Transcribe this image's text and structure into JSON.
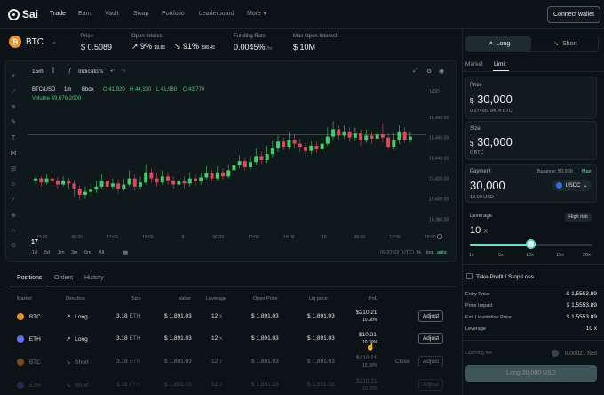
{
  "nav": {
    "brand": "Sai",
    "items": [
      "Trade",
      "Earn",
      "Vault",
      "Swap",
      "Portfolio",
      "Leaderboard",
      "More"
    ],
    "connect_wallet": "Connect wallet"
  },
  "market": {
    "symbol": "BTC",
    "price_label": "Price",
    "price": "$ 0.5089",
    "open_interest_label": "Open Interest",
    "oi_long_pct": "9%",
    "oi_long_val": "$9.85",
    "oi_short_pct": "91%",
    "oi_short_val": "$98.45",
    "funding_label": "Funding Rate",
    "funding": "0.0045%",
    "funding_unit": "/hr",
    "max_oi_label": "Max Open Interest",
    "max_oi": "$ 10M"
  },
  "chart_toolbar": {
    "interval": "15m",
    "indicators": "Indicators"
  },
  "chart_legend": {
    "pair": "BTC/USD",
    "tf": "1m",
    "exchange": "Bbox",
    "o": "O 41,920",
    "h": "H 44,330",
    "l": "L 41,960",
    "c": "C 43,770",
    "volume": "Volume 49,676,2000",
    "unit": "USD"
  },
  "chart_footer": {
    "ranges": [
      "1d",
      "5d",
      "1m",
      "3m",
      "6m",
      "All"
    ],
    "time": "09:27:02 (UTC)",
    "pct": "%",
    "log": "log",
    "auto": "auto"
  },
  "chart_data": {
    "type": "candlestick",
    "y_ticks": [
      "15,480.00",
      "15,460.00",
      "15,440.00",
      "15,420.00",
      "15,400.00",
      "15,380.00"
    ],
    "x_ticks": [
      "12:00",
      "06:00",
      "12:00",
      "18:00",
      "8",
      "06:00",
      "12:00",
      "18:00",
      "15",
      "06:00",
      "12:00",
      "18:00"
    ],
    "ylim": [
      15370,
      15492
    ],
    "candles": [
      [
        15418,
        15420,
        15423,
        15414
      ],
      [
        15420,
        15416,
        15422,
        15412
      ],
      [
        15416,
        15420,
        15424,
        15414
      ],
      [
        15420,
        15418,
        15423,
        15413
      ],
      [
        15418,
        15414,
        15421,
        15410
      ],
      [
        15414,
        15418,
        15422,
        15412
      ],
      [
        15418,
        15415,
        15421,
        15409
      ],
      [
        15415,
        15410,
        15418,
        15402
      ],
      [
        15410,
        15404,
        15413,
        15399
      ],
      [
        15404,
        15407,
        15412,
        15400
      ],
      [
        15407,
        15409,
        15414,
        15403
      ],
      [
        15409,
        15412,
        15418,
        15406
      ],
      [
        15412,
        15418,
        15424,
        15410
      ],
      [
        15418,
        15412,
        15422,
        15408
      ],
      [
        15412,
        15415,
        15420,
        15409
      ],
      [
        15415,
        15410,
        15419,
        15406
      ],
      [
        15410,
        15414,
        15420,
        15408
      ],
      [
        15414,
        15420,
        15428,
        15412
      ],
      [
        15420,
        15412,
        15424,
        15408
      ],
      [
        15412,
        15416,
        15422,
        15410
      ],
      [
        15416,
        15426,
        15434,
        15414
      ],
      [
        15426,
        15420,
        15430,
        15416
      ],
      [
        15420,
        15416,
        15426,
        15412
      ],
      [
        15416,
        15422,
        15428,
        15414
      ],
      [
        15422,
        15418,
        15426,
        15414
      ],
      [
        15418,
        15414,
        15422,
        15410
      ],
      [
        15414,
        15418,
        15424,
        15412
      ],
      [
        15418,
        15415,
        15422,
        15410
      ],
      [
        15415,
        15420,
        15426,
        15412
      ],
      [
        15420,
        15417,
        15424,
        15413
      ],
      [
        15417,
        15421,
        15426,
        15414
      ],
      [
        15421,
        15425,
        15432,
        15419
      ],
      [
        15425,
        15420,
        15429,
        15417
      ],
      [
        15420,
        15426,
        15432,
        15418
      ],
      [
        15426,
        15422,
        15430,
        15419
      ],
      [
        15422,
        15428,
        15434,
        15420
      ],
      [
        15428,
        15433,
        15440,
        15425
      ],
      [
        15433,
        15437,
        15443,
        15430
      ],
      [
        15437,
        15431,
        15440,
        15428
      ],
      [
        15431,
        15436,
        15442,
        15428
      ],
      [
        15436,
        15442,
        15450,
        15433
      ],
      [
        15442,
        15438,
        15446,
        15434
      ],
      [
        15438,
        15444,
        15452,
        15435
      ],
      [
        15444,
        15450,
        15457,
        15440
      ],
      [
        15450,
        15456,
        15462,
        15446
      ],
      [
        15456,
        15451,
        15460,
        15448
      ],
      [
        15451,
        15458,
        15466,
        15448
      ],
      [
        15458,
        15454,
        15463,
        15450
      ],
      [
        15454,
        15451,
        15459,
        15446
      ],
      [
        15451,
        15447,
        15455,
        15442
      ],
      [
        15447,
        15452,
        15457,
        15444
      ],
      [
        15452,
        15449,
        15456,
        15445
      ],
      [
        15449,
        15454,
        15460,
        15446
      ],
      [
        15454,
        15461,
        15470,
        15452
      ],
      [
        15461,
        15468,
        15476,
        15458
      ],
      [
        15468,
        15462,
        15472,
        15458
      ],
      [
        15462,
        15466,
        15472,
        15459
      ],
      [
        15466,
        15460,
        15470,
        15456
      ],
      [
        15460,
        15464,
        15470,
        15457
      ],
      [
        15464,
        15458,
        15468,
        15452
      ],
      [
        15458,
        15462,
        15468,
        15455
      ],
      [
        15462,
        15459,
        15466,
        15454
      ],
      [
        15459,
        15463,
        15470,
        15456
      ],
      [
        15463,
        15460,
        15474,
        15455
      ],
      [
        15460,
        15451,
        15465,
        15448
      ],
      [
        15451,
        15458,
        15464,
        15448
      ],
      [
        15458,
        15466,
        15472,
        15454
      ],
      [
        15466,
        15458,
        15470,
        15455
      ],
      [
        15458,
        15461,
        15466,
        15455
      ]
    ],
    "reference_line": 15463
  },
  "positions": {
    "tabs": [
      "Positions",
      "Orders",
      "History"
    ],
    "headers": [
      "Market",
      "Direction",
      "Size",
      "Value",
      "Leverage",
      "Open Price",
      "Liq price",
      "PnL"
    ],
    "rows": [
      {
        "market": "BTC",
        "dir": "Long",
        "size": "3.18",
        "size_unit": "ETH",
        "value": "$ 1,891.03",
        "lev": "12",
        "lev_unit": "x",
        "open": "$ 1,891.03",
        "liq": "$ 1,891.03",
        "pnl": "$210.21",
        "pnl_pct": "10.30%",
        "action": "Adjust",
        "pnl_color": "green",
        "dir_color": "green",
        "coin_color": "#f0902a"
      },
      {
        "market": "ETH",
        "dir": "Long",
        "size": "3.18",
        "size_unit": "ETH",
        "value": "$ 1,891.03",
        "lev": "12",
        "lev_unit": "x",
        "open": "$ 1,891.03",
        "liq": "$ 1,891.03",
        "pnl": "$10.21",
        "pnl_pct": "10.30%",
        "action": "Adjust",
        "pnl_color": "red",
        "dir_color": "green",
        "coin_color": "#6a6ff0"
      },
      {
        "market": "BTC",
        "dir": "Short",
        "size": "3.18",
        "size_unit": "ETH",
        "value": "$ 1,891.03",
        "lev": "12",
        "lev_unit": "x",
        "open": "$ 1,891.03",
        "liq": "$ 1,891.03",
        "pnl": "$210.21",
        "pnl_pct": "10.30%",
        "close": "Close",
        "action": "Adjust",
        "pnl_color": "green",
        "dir_color": "red",
        "coin_color": "#f0902a"
      },
      {
        "market": "ETH",
        "dir": "Short",
        "size": "3.18",
        "size_unit": "ETH",
        "value": "$ 1,891.03",
        "lev": "12",
        "lev_unit": "x",
        "open": "$ 1,891.03",
        "liq": "$ 1,891.03",
        "pnl": "$210.21",
        "pnl_pct": "10.30%",
        "action": "Adjust",
        "pnl_color": "green",
        "dir_color": "red",
        "coin_color": "#6a6ff0"
      }
    ]
  },
  "order": {
    "long": "Long",
    "short": "Short",
    "tabs": [
      "Market",
      "Limit"
    ],
    "price_label": "Price",
    "price_prefix": "$",
    "price_value": "30,000",
    "price_sub": "0.2749578414 BTC",
    "size_label": "Size",
    "size_prefix": "$",
    "size_value": "30,000",
    "size_sub": "0 BTC",
    "payment_label": "Payment",
    "balance": "Balance: 50,000",
    "max": "Max",
    "payment_value": "30,000",
    "payment_sub": "13.00 USD",
    "token": "USDC",
    "leverage_label": "Leverage",
    "high_risk": "High risk",
    "leverage_value": "10",
    "leverage_unit": "X",
    "leverage_fraction": 0.5,
    "ticks": [
      "1x",
      "5x",
      "10x",
      "15x",
      "20x"
    ],
    "tpsl": "Take Profit / Stop Loss",
    "stats": [
      {
        "label": "Entry Price",
        "value": "$ 1,5553.89"
      },
      {
        "label": "Price Impact",
        "value": "$ 1,5553.89"
      },
      {
        "label": "Est. Liquidation Price",
        "value": "$ 1,5553.89"
      },
      {
        "label": "Leverage",
        "value": "10 x"
      }
    ],
    "opening_fee_label": "Opening fee",
    "opening_fee": "0.00021 NBI",
    "submit": "Long 30,000 USD"
  }
}
